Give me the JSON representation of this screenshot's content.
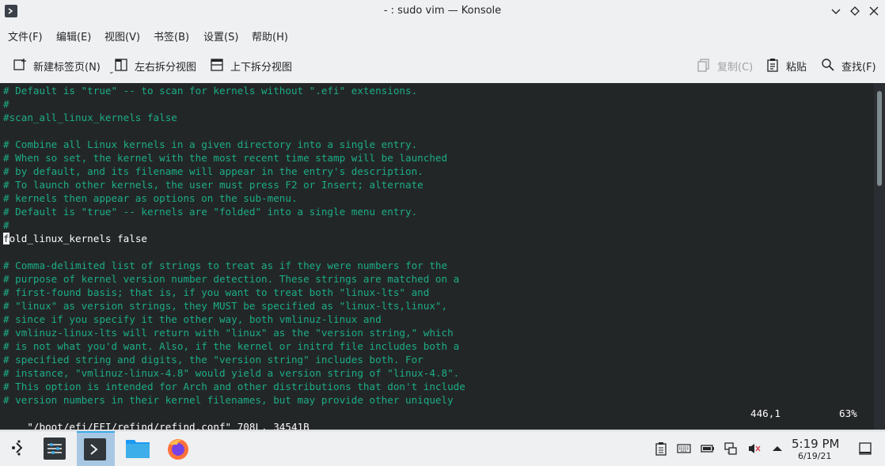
{
  "window": {
    "title": "- : sudo vim — Konsole"
  },
  "menu": [
    "文件(F)",
    "编辑(E)",
    "视图(V)",
    "书签(B)",
    "设置(S)",
    "帮助(H)"
  ],
  "toolbar": {
    "new_tab": "新建标签页(N)",
    "split_lr": "左右拆分视图",
    "split_tb": "上下拆分视图",
    "copy": "复制(C)",
    "paste": "粘贴",
    "find": "查找(F)"
  },
  "terminal": {
    "lines": [
      {
        "text": "# Default is \"true\" -- to scan for kernels without \".efi\" extensions.",
        "type": "comment"
      },
      {
        "text": "#",
        "type": "comment"
      },
      {
        "text": "#scan_all_linux_kernels false",
        "type": "comment"
      },
      {
        "text": "",
        "type": "blank"
      },
      {
        "text": "# Combine all Linux kernels in a given directory into a single entry.",
        "type": "comment"
      },
      {
        "text": "# When so set, the kernel with the most recent time stamp will be launched",
        "type": "comment"
      },
      {
        "text": "# by default, and its filename will appear in the entry's description.",
        "type": "comment"
      },
      {
        "text": "# To launch other kernels, the user must press F2 or Insert; alternate",
        "type": "comment"
      },
      {
        "text": "# kernels then appear as options on the sub-menu.",
        "type": "comment"
      },
      {
        "text": "# Default is \"true\" -- kernels are \"folded\" into a single menu entry.",
        "type": "comment"
      },
      {
        "text": "#",
        "type": "comment"
      },
      {
        "text": "fold_linux_kernels false",
        "type": "cursor"
      },
      {
        "text": "",
        "type": "blank"
      },
      {
        "text": "# Comma-delimited list of strings to treat as if they were numbers for the",
        "type": "comment"
      },
      {
        "text": "# purpose of kernel version number detection. These strings are matched on a",
        "type": "comment"
      },
      {
        "text": "# first-found basis; that is, if you want to treat both \"linux-lts\" and",
        "type": "comment"
      },
      {
        "text": "# \"linux\" as version strings, they MUST be specified as \"linux-lts,linux\",",
        "type": "comment"
      },
      {
        "text": "# since if you specify it the other way, both vmlinuz-linux and",
        "type": "comment"
      },
      {
        "text": "# vmlinuz-linux-lts will return with \"linux\" as the \"version string,\" which",
        "type": "comment"
      },
      {
        "text": "# is not what you'd want. Also, if the kernel or initrd file includes both a",
        "type": "comment"
      },
      {
        "text": "# specified string and digits, the \"version string\" includes both. For",
        "type": "comment"
      },
      {
        "text": "# instance, \"vmlinuz-linux-4.8\" would yield a version string of \"linux-4.8\".",
        "type": "comment"
      },
      {
        "text": "# This option is intended for Arch and other distributions that don't include",
        "type": "comment"
      },
      {
        "text": "# version numbers in their kernel filenames, but may provide other uniquely",
        "type": "comment"
      }
    ],
    "status_file": "\"/boot/efi/EFI/refind/refind.conf\" 708L, 34541B",
    "status_pos": "446,1",
    "status_pct": "63%",
    "scroll_fraction": 0.63
  },
  "colors": {
    "comment": "#1cad86",
    "text": "#fcfcfc",
    "background": "#232627",
    "accent": "#3daee9"
  },
  "taskbar": {
    "items": [
      "application-launcher-icon",
      "system-settings-icon",
      "konsole-icon",
      "dolphin-folder-icon",
      "firefox-icon"
    ],
    "tray": [
      "clipboard-icon",
      "keyboard-icon",
      "battery-icon",
      "network-icon",
      "volume-muted-icon",
      "tray-expand-icon"
    ],
    "time": "5:19 PM",
    "date": "6/19/21"
  }
}
